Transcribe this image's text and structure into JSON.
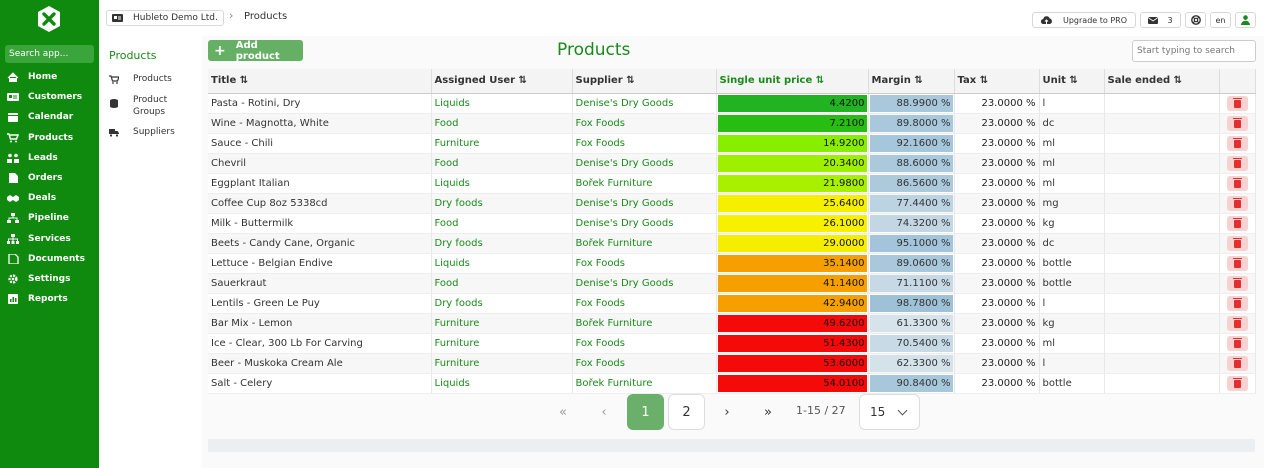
{
  "sidebar": {
    "search_placeholder": "Search app...",
    "items": [
      {
        "label": "Home",
        "icon": "home-icon"
      },
      {
        "label": "Customers",
        "icon": "id-card-icon"
      },
      {
        "label": "Calendar",
        "icon": "calendar-icon"
      },
      {
        "label": "Products",
        "icon": "cart-icon"
      },
      {
        "label": "Leads",
        "icon": "leads-icon"
      },
      {
        "label": "Orders",
        "icon": "file-icon"
      },
      {
        "label": "Deals",
        "icon": "handshake-icon"
      },
      {
        "label": "Pipeline",
        "icon": "sitemap-icon"
      },
      {
        "label": "Services",
        "icon": "network-icon"
      },
      {
        "label": "Documents",
        "icon": "document-icon"
      },
      {
        "label": "Settings",
        "icon": "gear-icon"
      },
      {
        "label": "Reports",
        "icon": "chart-icon"
      }
    ]
  },
  "subnav": {
    "title": "Products",
    "items": [
      {
        "label": "Products",
        "icon": "cart-icon"
      },
      {
        "label": "Product Groups",
        "icon": "database-icon"
      },
      {
        "label": "Suppliers",
        "icon": "truck-icon"
      }
    ]
  },
  "topbar": {
    "company": "Hubleto Demo Ltd.",
    "breadcrumb": "Products",
    "upgrade": "Upgrade to PRO",
    "mail_count": "3",
    "language": "en"
  },
  "main": {
    "add_button": "Add product",
    "title": "Products",
    "search_placeholder": "Start typing to search"
  },
  "table": {
    "columns": [
      "Title ⇅",
      "Assigned User ⇅",
      "Supplier ⇅",
      "Single unit price ⇅",
      "Margin ⇅",
      "Tax ⇅",
      "Unit ⇅",
      "Sale ended ⇅"
    ],
    "rows": [
      {
        "title": "Pasta - Rotini, Dry",
        "user": "Liquids",
        "supplier": "Denise's Dry Goods",
        "price": "4.4200",
        "price_color": "#22b322",
        "margin": "88.9900 %",
        "margin_color": "#a9c8dc",
        "tax": "23.0000 %",
        "unit": "l",
        "sale_ended": ""
      },
      {
        "title": "Wine - Magnotta, White",
        "user": "Food",
        "supplier": "Fox Foods",
        "price": "7.2100",
        "price_color": "#27bd12",
        "margin": "89.8000 %",
        "margin_color": "#a9c8dc",
        "tax": "23.0000 %",
        "unit": "dc",
        "sale_ended": ""
      },
      {
        "title": "Sauce - Chili",
        "user": "Furniture",
        "supplier": "Fox Foods",
        "price": "14.9200",
        "price_color": "#88ee00",
        "margin": "92.1600 %",
        "margin_color": "#a6c6db",
        "tax": "23.0000 %",
        "unit": "ml",
        "sale_ended": ""
      },
      {
        "title": "Chevril",
        "user": "Food",
        "supplier": "Denise's Dry Goods",
        "price": "20.3400",
        "price_color": "#9ef000",
        "margin": "88.6000 %",
        "margin_color": "#aac9dc",
        "tax": "23.0000 %",
        "unit": "ml",
        "sale_ended": ""
      },
      {
        "title": "Eggplant Italian",
        "user": "Liquids",
        "supplier": "Bořek Furniture",
        "price": "21.9800",
        "price_color": "#a6f000",
        "margin": "86.5600 %",
        "margin_color": "#adcadd",
        "tax": "23.0000 %",
        "unit": "ml",
        "sale_ended": ""
      },
      {
        "title": "Coffee Cup 8oz 5338cd",
        "user": "Dry foods",
        "supplier": "Denise's Dry Goods",
        "price": "25.6400",
        "price_color": "#f5f000",
        "margin": "77.4400 %",
        "margin_color": "#bcd3e1",
        "tax": "23.0000 %",
        "unit": "mg",
        "sale_ended": ""
      },
      {
        "title": "Milk - Buttermilk",
        "user": "Food",
        "supplier": "Denise's Dry Goods",
        "price": "26.1000",
        "price_color": "#f7f000",
        "margin": "74.3200 %",
        "margin_color": "#c2d6e3",
        "tax": "23.0000 %",
        "unit": "kg",
        "sale_ended": ""
      },
      {
        "title": "Beets - Candy Cane, Organic",
        "user": "Dry foods",
        "supplier": "Bořek Furniture",
        "price": "29.0000",
        "price_color": "#f5ee00",
        "margin": "95.1000 %",
        "margin_color": "#a3c4da",
        "tax": "23.0000 %",
        "unit": "dc",
        "sale_ended": ""
      },
      {
        "title": "Lettuce - Belgian Endive",
        "user": "Liquids",
        "supplier": "Fox Foods",
        "price": "35.1400",
        "price_color": "#f5a000",
        "margin": "89.0600 %",
        "margin_color": "#a9c8dc",
        "tax": "23.0000 %",
        "unit": "bottle",
        "sale_ended": ""
      },
      {
        "title": "Sauerkraut",
        "user": "Food",
        "supplier": "Denise's Dry Goods",
        "price": "41.1400",
        "price_color": "#f5a000",
        "margin": "71.1100 %",
        "margin_color": "#c6d9e5",
        "tax": "23.0000 %",
        "unit": "bottle",
        "sale_ended": ""
      },
      {
        "title": "Lentils - Green Le Puy",
        "user": "Dry foods",
        "supplier": "Fox Foods",
        "price": "42.9400",
        "price_color": "#f5a000",
        "margin": "98.7800 %",
        "margin_color": "#9fc1d8",
        "tax": "23.0000 %",
        "unit": "l",
        "sale_ended": ""
      },
      {
        "title": "Bar Mix - Lemon",
        "user": "Furniture",
        "supplier": "Bořek Furniture",
        "price": "49.6200",
        "price_color": "#f50a0a",
        "margin": "61.3300 %",
        "margin_color": "#d6e3ea",
        "tax": "23.0000 %",
        "unit": "kg",
        "sale_ended": ""
      },
      {
        "title": "Ice - Clear, 300 Lb For Carving",
        "user": "Furniture",
        "supplier": "Fox Foods",
        "price": "51.4300",
        "price_color": "#f50a0a",
        "margin": "70.5400 %",
        "margin_color": "#c7dae5",
        "tax": "23.0000 %",
        "unit": "ml",
        "sale_ended": ""
      },
      {
        "title": "Beer - Muskoka Cream Ale",
        "user": "Furniture",
        "supplier": "Fox Foods",
        "price": "53.6000",
        "price_color": "#f50a0a",
        "margin": "62.3300 %",
        "margin_color": "#d4e2ea",
        "tax": "23.0000 %",
        "unit": "l",
        "sale_ended": ""
      },
      {
        "title": "Salt - Celery",
        "user": "Liquids",
        "supplier": "Bořek Furniture",
        "price": "54.0100",
        "price_color": "#f50a0a",
        "margin": "90.8400 %",
        "margin_color": "#a7c7db",
        "tax": "23.0000 %",
        "unit": "bottle",
        "sale_ended": ""
      }
    ]
  },
  "pagination": {
    "first": "«",
    "prev": "‹",
    "pages": [
      "1",
      "2"
    ],
    "active_page": "1",
    "next": "›",
    "last": "»",
    "range": "1-15 / 27",
    "per_page": "15"
  }
}
